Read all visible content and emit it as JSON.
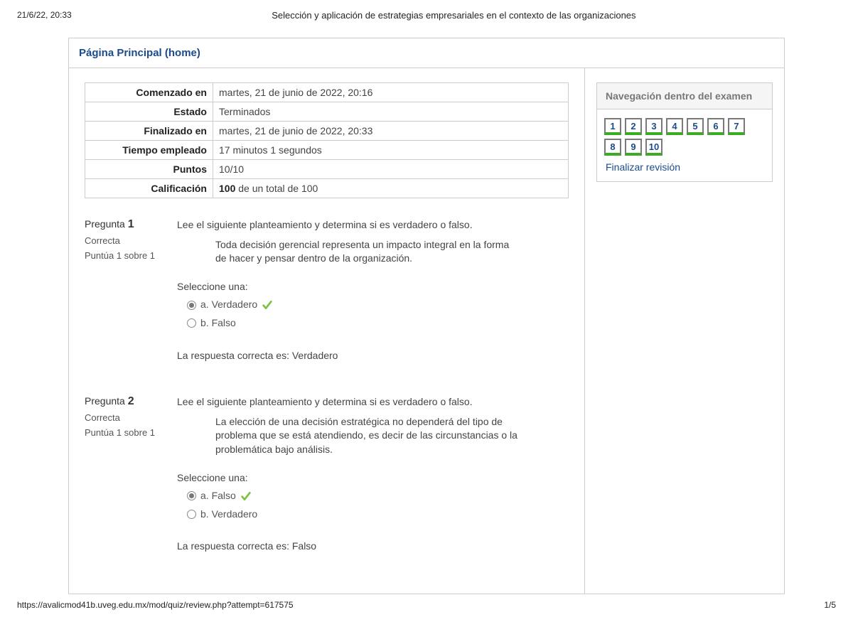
{
  "header": {
    "timestamp": "21/6/22, 20:33",
    "title": "Selección y aplicación de estrategias empresariales en el contexto de las organizaciones"
  },
  "breadcrumb": {
    "home": "Página Principal (home)"
  },
  "summary": {
    "rows": [
      {
        "label": "Comenzado en",
        "value": "martes, 21 de junio de 2022, 20:16"
      },
      {
        "label": "Estado",
        "value": "Terminados"
      },
      {
        "label": "Finalizado en",
        "value": "martes, 21 de junio de 2022, 20:33"
      },
      {
        "label": "Tiempo empleado",
        "value": "17 minutos 1 segundos"
      },
      {
        "label": "Puntos",
        "value": "10/10"
      }
    ],
    "grade_label": "Calificación",
    "grade_bold": "100",
    "grade_rest": " de un total de 100"
  },
  "questions": [
    {
      "num": "1",
      "title_prefix": "Pregunta ",
      "status": "Correcta",
      "score": "Puntúa 1 sobre 1",
      "prompt": "Lee el siguiente planteamiento y determina si es verdadero o falso.",
      "statement": "Toda decisión gerencial representa un impacto integral en la forma de hacer y pensar dentro de la organización.",
      "select_label": "Seleccione una:",
      "options": [
        {
          "text": "a. Verdadero",
          "selected": true,
          "correct": true
        },
        {
          "text": "b. Falso",
          "selected": false,
          "correct": false
        }
      ],
      "feedback": "La respuesta correcta es: Verdadero"
    },
    {
      "num": "2",
      "title_prefix": "Pregunta ",
      "status": "Correcta",
      "score": "Puntúa 1 sobre 1",
      "prompt": "Lee el siguiente planteamiento y determina si es verdadero o falso.",
      "statement": "La elección de una decisión estratégica no dependerá del tipo de problema que se está atendiendo, es decir de las circunstancias o la problemática bajo análisis.",
      "select_label": "Seleccione una:",
      "options": [
        {
          "text": "a. Falso",
          "selected": true,
          "correct": true
        },
        {
          "text": "b. Verdadero",
          "selected": false,
          "correct": false
        }
      ],
      "feedback": "La respuesta correcta es: Falso"
    }
  ],
  "nav": {
    "title": "Navegación dentro del examen",
    "items": [
      "1",
      "2",
      "3",
      "4",
      "5",
      "6",
      "7",
      "8",
      "9",
      "10"
    ],
    "finish": "Finalizar revisión"
  },
  "footer": {
    "url": "https://avalicmod41b.uveg.edu.mx/mod/quiz/review.php?attempt=617575",
    "page": "1/5"
  }
}
